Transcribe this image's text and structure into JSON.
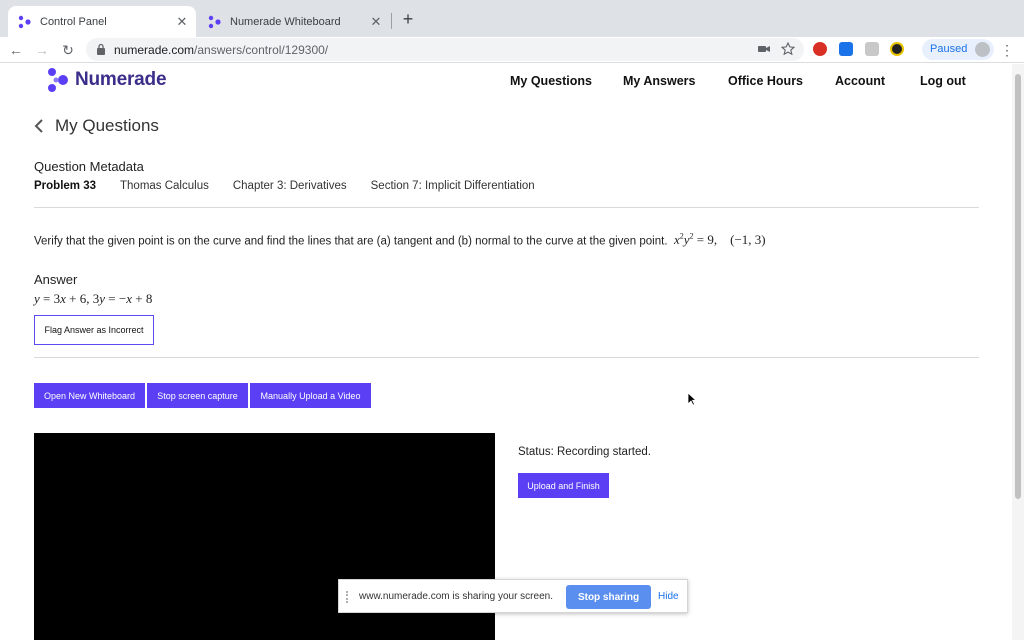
{
  "browser": {
    "tabs": [
      {
        "title": "Control Panel",
        "active": true
      },
      {
        "title": "Numerade Whiteboard",
        "active": false
      }
    ],
    "new_tab": "+",
    "url_host": "numerade.com",
    "url_path": "/answers/control/129300/",
    "profile_label": "Paused"
  },
  "header": {
    "logo_text": "Numerade",
    "nav": [
      "My Questions",
      "My Answers",
      "Office Hours",
      "Account",
      "Log out"
    ]
  },
  "page": {
    "back_label": "My Questions",
    "metadata_title": "Question Metadata",
    "problem": "Problem 33",
    "book": "Thomas Calculus",
    "chapter": "Chapter 3: Derivatives",
    "section": "Section 7: Implicit Differentiation",
    "question_text": "Verify that the given point is on the curve and find the lines that are (a) tangent and (b) normal to the curve at the given point.",
    "answer_label": "Answer",
    "flag_button": "Flag Answer as Incorrect",
    "buttons": {
      "open_whiteboard": "Open New Whiteboard",
      "stop_capture": "Stop screen capture",
      "manual_upload": "Manually Upload a Video",
      "upload_finish": "Upload and Finish"
    },
    "status": "Status: Recording started."
  },
  "share_bar": {
    "text": "www.numerade.com is sharing your screen.",
    "stop": "Stop sharing",
    "hide": "Hide"
  },
  "colors": {
    "brand": "#3b2e8a",
    "button": "#5b3ff5",
    "share_button": "#5b8fef"
  }
}
